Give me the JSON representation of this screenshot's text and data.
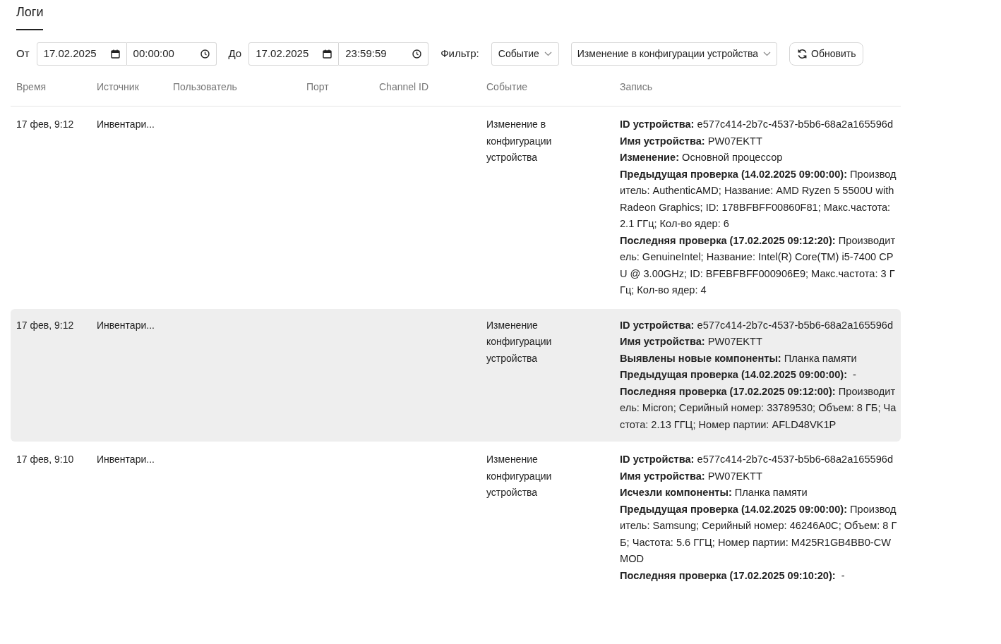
{
  "tabs": [
    {
      "label": "Логи",
      "selected": true
    }
  ],
  "filters": {
    "from_label": "От",
    "from_date": "17.02.2025",
    "from_time": "00:00:00",
    "to_label": "До",
    "to_date": "17.02.2025",
    "to_time": "23:59:59",
    "filter_label": "Фильтр:",
    "filter_field": "Событие",
    "filter_value": "Изменение в конфигурации устройства",
    "refresh_button": "Обновить"
  },
  "table": {
    "columns": [
      "Время",
      "Источник",
      "Пользователь",
      "Порт",
      "Channel ID",
      "Событие",
      "Запись"
    ],
    "rows": [
      {
        "selected": false,
        "time": "17 фев, 9:12",
        "source": "Инвентари...",
        "event": "Изменение в конфигурации устройства",
        "record": [
          "**ID устройства:** e577c414-2b7c-4537-b5b6-68a2a165596d",
          "**Имя устройства:** PW07EKTT",
          "**Изменение:** Основной процессор",
          "**Предыдущая проверка (14.02.2025 09:00:00):** Производитель: AuthenticAMD; Название: AMD Ryzen 5 5500U with Radeon Graphics; ID: 178BFBFF00860F81; Макс.частота: 2.1 ГГц; Кол-во ядер: 6",
          "**Последняя проверка (17.02.2025 09:12:20):** Производитель: GenuineIntel; Название: Intel(R) Core(TM) i5-7400 CPU @ 3.00GHz; ID: BFEBFBFF000906E9; Макс.частота: 3 ГГц; Кол-во ядер: 4"
        ]
      },
      {
        "selected": true,
        "time": "17 фев, 9:12",
        "source": "Инвентари...",
        "event": "Изменение конфигурации устройства",
        "record": [
          "**ID устройства:** e577c414-2b7c-4537-b5b6-68a2a165596d",
          "**Имя устройства:** PW07EKTT",
          "**Выявлены новые компоненты:** Планка памяти",
          "**Предыдущая проверка (14.02.2025 09:00:00):**  -",
          "**Последняя проверка (17.02.2025 09:12:00):** Производитель: Micron; Серийный номер: 33789530; Объем: 8 ГБ; Частота: 2.13 ГГЦ; Номер партии: AFLD48VK1P"
        ]
      },
      {
        "selected": false,
        "time": "17 фев, 9:10",
        "source": "Инвентари...",
        "event": "Изменение конфигурации устройства",
        "record": [
          "**ID устройства:** e577c414-2b7c-4537-b5b6-68a2a165596d",
          "**Имя устройства:** PW07EKTT",
          "**Исчезли компоненты:** Планка памяти",
          "**Предыдущая проверка (14.02.2025 09:00:00):** Производитель: Samsung; Серийный номер: 46246A0C; Объем: 8 ГБ; Частота: 5.6 ГГЦ; Номер партии: M425R1GB4BB0-CWMOD",
          "**Последняя проверка (17.02.2025 09:10:20):**  -"
        ]
      }
    ]
  }
}
